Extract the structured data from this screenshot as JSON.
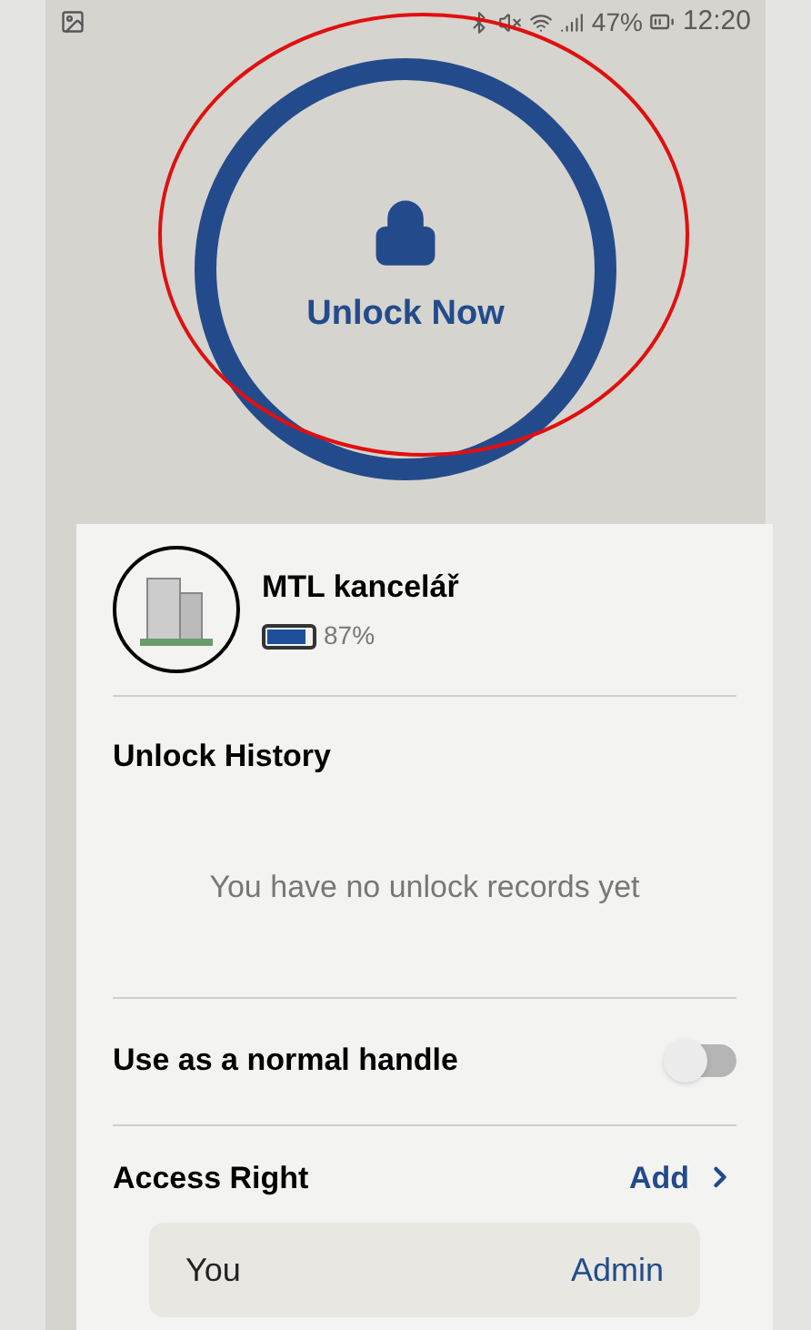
{
  "status_bar": {
    "battery": "47%",
    "time": "12:20"
  },
  "unlock_button": {
    "label": "Unlock Now"
  },
  "lock": {
    "name": "MTL kancelář",
    "battery": "87%",
    "battery_gauge": {
      "level": 0.87
    }
  },
  "unlock_history": {
    "title": "Unlock History",
    "empty_message": "You have no unlock records yet"
  },
  "normal_handle": {
    "label": "Use as a normal handle",
    "on": false
  },
  "access_right": {
    "title": "Access Right",
    "add_label": "Add",
    "users": [
      {
        "name": "You",
        "role": "Admin"
      }
    ]
  }
}
